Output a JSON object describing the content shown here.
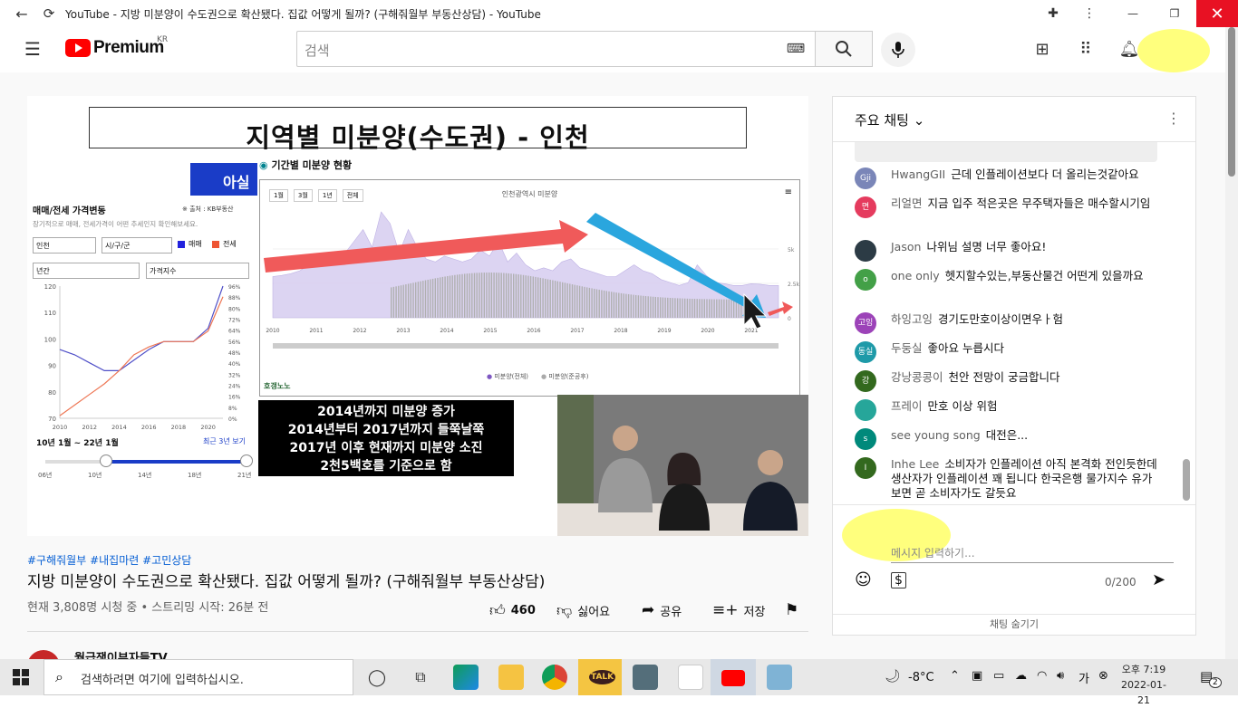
{
  "window": {
    "title": "YouTube - 지방 미분양이 수도권으로 확산됐다. 집값 어떻게 될까? (구해줘월부 부동산상담) - YouTube"
  },
  "header": {
    "logo": "Premium",
    "region": "KR",
    "search_placeholder": "검색"
  },
  "video": {
    "slide_title": "지역별 미분양(수도권) - 인천",
    "asil_label": "아실",
    "left_panel": {
      "heading": "매매/전세 가격변동",
      "source": "※ 출처 : KB부동산",
      "subtitle": "장기적으로 매매, 전세가격이 어떤 추세인지 확인해보세요.",
      "select_region": "인천",
      "select_district": "시/구/군",
      "legend_sale": "매매",
      "legend_jeonse": "전세",
      "select_period": "년간",
      "select_index": "가격지수",
      "y_ticks": [
        "120",
        "110",
        "100",
        "90",
        "80",
        "70"
      ],
      "y2_ticks": [
        "96%",
        "88%",
        "80%",
        "72%",
        "64%",
        "56%",
        "48%",
        "40%",
        "32%",
        "24%",
        "16%",
        "8%",
        "0%"
      ],
      "x_ticks": [
        "2010",
        "2012",
        "2014",
        "2016",
        "2018",
        "2020"
      ],
      "range_label": "10년 1월 ~ 22년 1월",
      "range_link": "최근 3년 보기",
      "slider_ticks": [
        "06년",
        "10년",
        "14년",
        "18년",
        "21년"
      ],
      "range_fraction": [
        0.3,
        1.0
      ]
    },
    "chart2": {
      "header": "기간별 미분양 현황",
      "title": "인천광역시 미분양",
      "buttons": [
        "1월",
        "3월",
        "1년",
        "전체"
      ],
      "x_ticks": [
        "2010",
        "2011",
        "2012",
        "2013",
        "2014",
        "2015",
        "2016",
        "2017",
        "2018",
        "2019",
        "2020",
        "2021"
      ],
      "y_ticks": [
        "5k",
        "2.5k",
        "0"
      ],
      "legend": [
        "미분양(전체)",
        "미분양(준공후)"
      ],
      "watermark": "호갱노노"
    },
    "caption_lines": [
      "2014년까지 미분양 증가",
      "2014년부터 2017년까지 들쭉날쭉",
      "2017년 이후 현재까지 미분양 소진",
      "2천5백호를 기준으로 함"
    ]
  },
  "below": {
    "tags": "#구해줘월부 #내집마련 #고민상담",
    "title": "지방 미분양이 수도권으로 확산됐다. 집값 어떻게 될까? (구해줘월부 부동산상담)",
    "views": "현재 3,808명 시청 중 • 스트리밍 시작: 26분 전",
    "likes": "460",
    "dislike": "싫어요",
    "share": "공유",
    "save": "저장",
    "channel": "월급쟁이부자들TV"
  },
  "chat": {
    "header": "주요 채팅",
    "messages": [
      {
        "author": "HwangGII",
        "text": "근데 인플레이션보다 더 올리는것같아요",
        "avatar": "Gji",
        "color": "#7a86b8"
      },
      {
        "author": "리얼면",
        "text": "지금 입주 적은곳은 무주택자들은 매수할시기임",
        "avatar": "면",
        "color": "#e53b5e"
      },
      {
        "author": "Jason",
        "text": "나위님 설명 너무 좋아요!",
        "avatar": "",
        "color": "#2c3b45"
      },
      {
        "author": "one only",
        "text": "헷지할수있는,부동산물건 어떤게 있을까요",
        "avatar": "o",
        "color": "#43a047"
      },
      {
        "author": "하잉고잉",
        "text": "경기도만호이상이면우ㅏ험",
        "avatar": "고잉",
        "color": "#9c43b8"
      },
      {
        "author": "두둥실",
        "text": "좋아요 누릅시다",
        "avatar": "동실",
        "color": "#1e9aa8"
      },
      {
        "author": "강낭콩콩이",
        "text": "천안 전망이 궁금합니다",
        "avatar": "강",
        "color": "#33691e"
      },
      {
        "author": "프레이",
        "text": "만호 이상 위험",
        "avatar": "",
        "color": "#26a69a"
      },
      {
        "author": "see young song",
        "text": "대전은...",
        "avatar": "s",
        "color": "#00897b"
      },
      {
        "author": "Inhe Lee",
        "text": "소비자가 인플레이션 아직 본격화 전인듯한데 생산자가 인플레이션 꽤 됩니다 한국은행 물가지수 유가 보면 곧 소비자가도 갈듯요",
        "avatar": "I",
        "color": "#33691e"
      }
    ],
    "input_placeholder": "메시지 입력하기...",
    "counter": "0/200",
    "hide": "채팅 숨기기"
  },
  "taskbar": {
    "search_placeholder": "검색하려면 여기에 입력하십시오.",
    "weather": "-8°C",
    "time": "오후 7:19",
    "date": "2022-01-21",
    "notif": "2"
  },
  "chart_data": [
    {
      "type": "line",
      "title": "매매/전세 가격변동",
      "x": [
        "2010",
        "2011",
        "2012",
        "2013",
        "2014",
        "2015",
        "2016",
        "2017",
        "2018",
        "2019",
        "2020",
        "2021"
      ],
      "series": [
        {
          "name": "매매",
          "values": [
            96,
            94,
            91,
            88,
            88,
            92,
            96,
            99,
            99,
            99,
            104,
            120
          ]
        },
        {
          "name": "전세",
          "values": [
            71,
            75,
            79,
            83,
            88,
            94,
            97,
            99,
            99,
            99,
            103,
            116
          ]
        }
      ],
      "ylim": [
        70,
        120
      ]
    }
  ]
}
